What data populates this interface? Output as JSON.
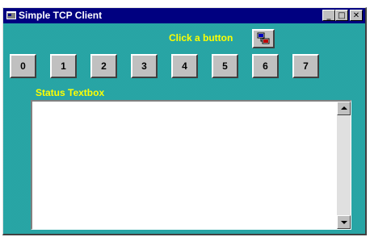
{
  "window": {
    "title": "Simple TCP Client",
    "minimize_glyph": "_",
    "maximize_glyph": "□",
    "close_glyph": "✕"
  },
  "header": {
    "prompt_label": "Click a button",
    "connect_icon": "network-computers-icon"
  },
  "number_buttons": [
    "0",
    "1",
    "2",
    "3",
    "4",
    "5",
    "6",
    "7"
  ],
  "status": {
    "label": "Status Textbox",
    "value": ""
  },
  "colors": {
    "form_background": "#2eb0b0",
    "titlebar": "#000080",
    "label_text": "#ffff00",
    "button_face": "#c0c0c0"
  }
}
